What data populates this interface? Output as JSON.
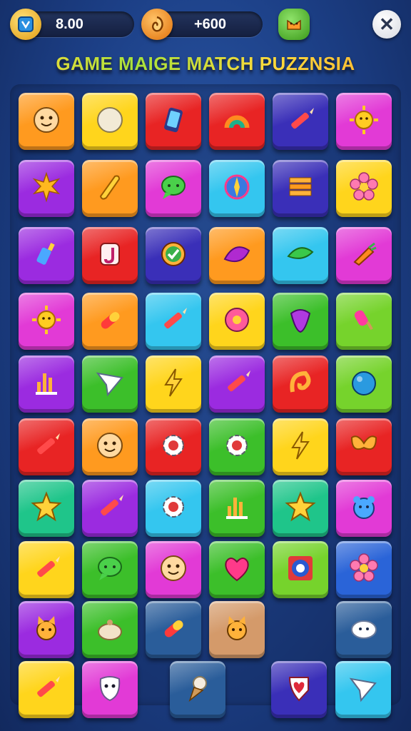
{
  "hud": {
    "coins": "8.00",
    "bonus": "+600"
  },
  "title": "GAME MAIGE MATCH PUZZNSIA",
  "close_label": "✕",
  "colors": {
    "orange": "#ff9a1f",
    "yellow": "#ffd51c",
    "red": "#e82424",
    "purple": "#9b2be0",
    "magenta": "#e23ad6",
    "cyan": "#34c6ef",
    "indigo": "#3a2fb8",
    "green": "#3cbf2a",
    "lime": "#76d32c",
    "teal": "#1fc58a",
    "navy": "#2a5d9a",
    "tan": "#d49a6a",
    "blue": "#2a64d8"
  },
  "tiles": [
    {
      "color": "orange",
      "icon": "face-icon"
    },
    {
      "color": "yellow",
      "icon": "circle-icon"
    },
    {
      "color": "red",
      "icon": "phone-icon"
    },
    {
      "color": "red",
      "icon": "arc-icon"
    },
    {
      "color": "indigo",
      "icon": "crayon-icon"
    },
    {
      "color": "magenta",
      "icon": "sun-icon"
    },
    {
      "color": "purple",
      "icon": "star-burst-icon"
    },
    {
      "color": "orange",
      "icon": "boomerang-icon"
    },
    {
      "color": "magenta",
      "icon": "chat-icon"
    },
    {
      "color": "cyan",
      "icon": "compass-icon"
    },
    {
      "color": "indigo",
      "icon": "stack-icon"
    },
    {
      "color": "yellow",
      "icon": "flower-icon"
    },
    {
      "color": "purple",
      "icon": "bottle-icon"
    },
    {
      "color": "red",
      "icon": "letter-j-icon"
    },
    {
      "color": "indigo",
      "icon": "check-circle-icon"
    },
    {
      "color": "orange",
      "icon": "leaf-icon"
    },
    {
      "color": "cyan",
      "icon": "pea-pod-icon"
    },
    {
      "color": "magenta",
      "icon": "carrot-icon"
    },
    {
      "color": "magenta",
      "icon": "sun-icon"
    },
    {
      "color": "orange",
      "icon": "pill-icon"
    },
    {
      "color": "cyan",
      "icon": "crayon-icon"
    },
    {
      "color": "yellow",
      "icon": "donut-icon"
    },
    {
      "color": "green",
      "icon": "gem-icon"
    },
    {
      "color": "lime",
      "icon": "popsicle-icon"
    },
    {
      "color": "purple",
      "icon": "bars-icon"
    },
    {
      "color": "green",
      "icon": "paper-plane-icon"
    },
    {
      "color": "yellow",
      "icon": "lightning-icon"
    },
    {
      "color": "purple",
      "icon": "crayon-icon"
    },
    {
      "color": "red",
      "icon": "swirl-icon"
    },
    {
      "color": "lime",
      "icon": "ball-icon"
    },
    {
      "color": "red",
      "icon": "crayon-icon"
    },
    {
      "color": "orange",
      "icon": "face-icon"
    },
    {
      "color": "red",
      "icon": "gear-icon"
    },
    {
      "color": "green",
      "icon": "gear-icon"
    },
    {
      "color": "yellow",
      "icon": "lightning-icon"
    },
    {
      "color": "red",
      "icon": "bow-icon"
    },
    {
      "color": "teal",
      "icon": "star-icon"
    },
    {
      "color": "purple",
      "icon": "crayon-icon"
    },
    {
      "color": "cyan",
      "icon": "gear-icon"
    },
    {
      "color": "green",
      "icon": "bars-icon"
    },
    {
      "color": "teal",
      "icon": "star-icon"
    },
    {
      "color": "magenta",
      "icon": "bear-icon"
    },
    {
      "color": "yellow",
      "icon": "crayon-icon"
    },
    {
      "color": "green",
      "icon": "chat-icon"
    },
    {
      "color": "magenta",
      "icon": "face-icon"
    },
    {
      "color": "green",
      "icon": "heart-icon"
    },
    {
      "color": "lime",
      "icon": "target-icon"
    },
    {
      "color": "blue",
      "icon": "flower-icon"
    },
    {
      "color": "purple",
      "icon": "cat-icon"
    },
    {
      "color": "green",
      "icon": "bun-icon"
    },
    {
      "color": "navy",
      "icon": "pill-icon"
    },
    {
      "color": "tan",
      "icon": "cat-icon"
    },
    {
      "color": "none",
      "icon": ""
    },
    {
      "color": "navy",
      "icon": "cloud-face-icon"
    },
    {
      "color": "yellow",
      "icon": "crayon-icon"
    },
    {
      "color": "magenta",
      "icon": "mask-icon"
    },
    {
      "color": "navy",
      "icon": "ice-cream-icon"
    },
    {
      "color": "indigo",
      "icon": "heart-shield-icon"
    },
    {
      "color": "cyan",
      "icon": "paper-plane-icon"
    }
  ]
}
